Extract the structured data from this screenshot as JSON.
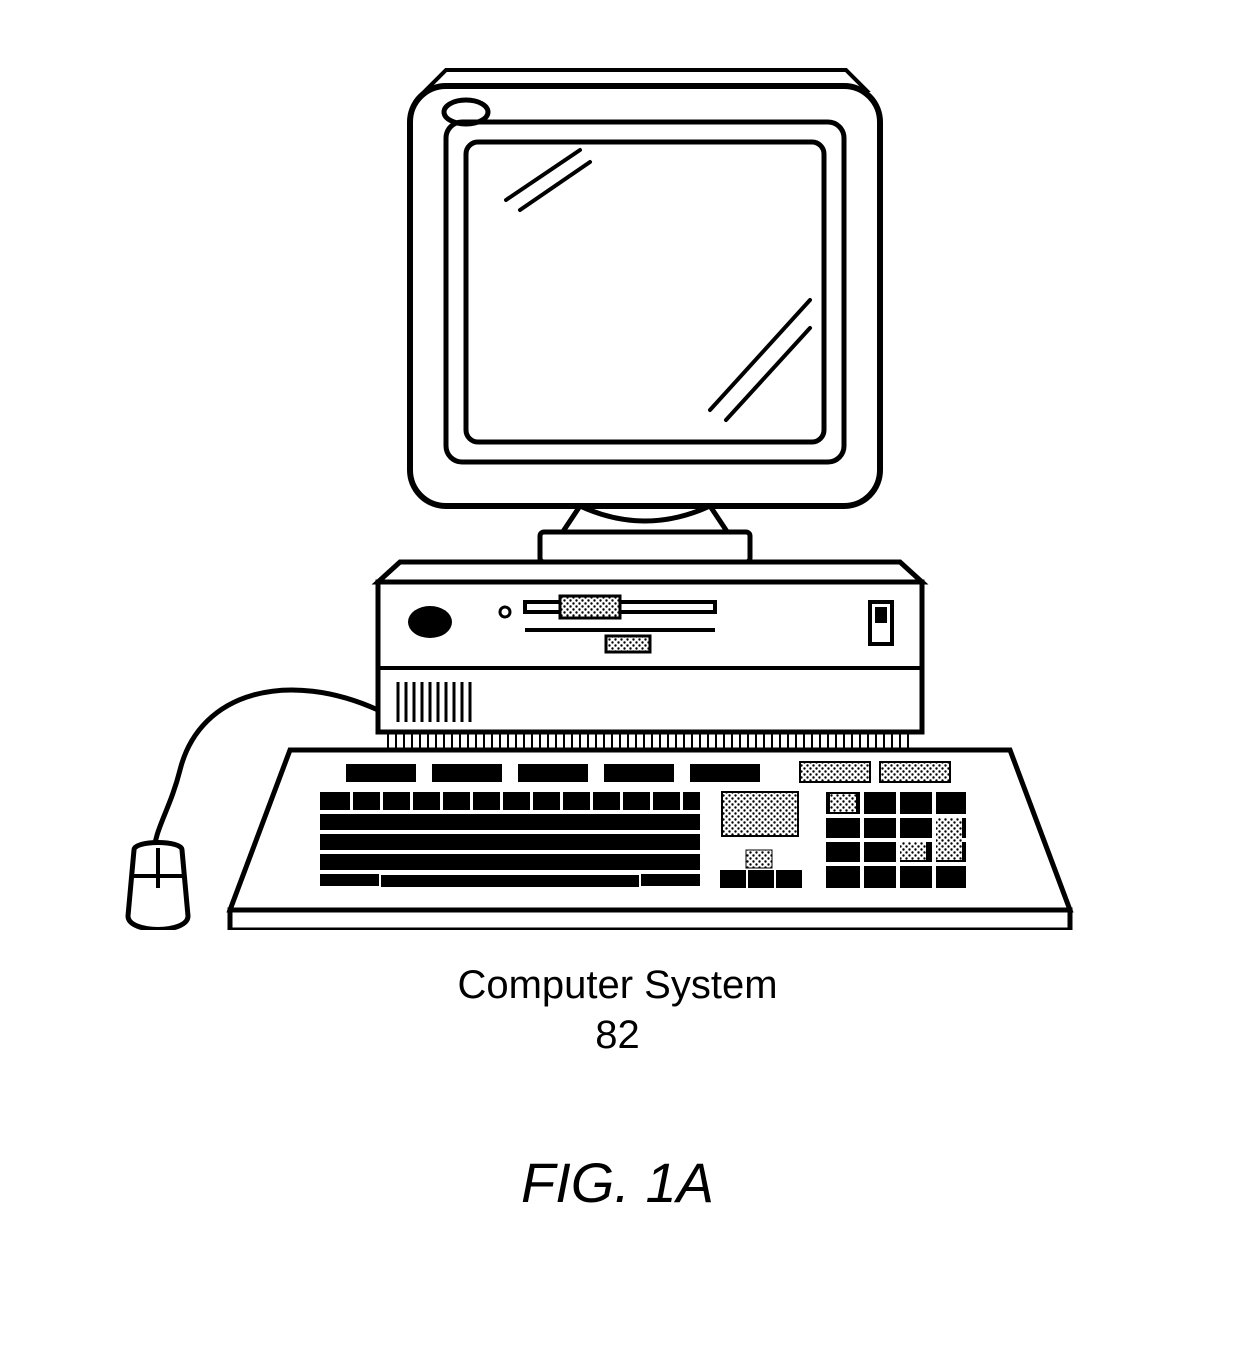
{
  "labels": {
    "component_name": "Computer System",
    "reference_number": "82",
    "figure_id": "FIG. 1A"
  },
  "icons": {
    "composite": "desktop-computer-with-keyboard-and-mouse"
  }
}
